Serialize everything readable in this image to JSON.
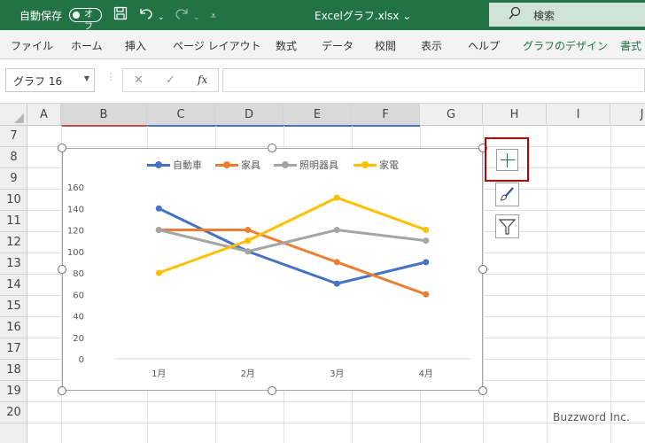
{
  "titlebar": {
    "autosave_label": "自動保存",
    "autosave_state": "オフ",
    "doc_title": "Excelグラフ.xlsx ⌄",
    "search_placeholder": "検索",
    "accent": "#217346"
  },
  "ribbon_tabs": [
    {
      "label": "ファイル",
      "active": false
    },
    {
      "label": "ホーム",
      "active": false
    },
    {
      "label": "挿入",
      "active": false
    },
    {
      "label": "ページ レイアウト",
      "active": false
    },
    {
      "label": "数式",
      "active": false
    },
    {
      "label": "データ",
      "active": false
    },
    {
      "label": "校閲",
      "active": false
    },
    {
      "label": "表示",
      "active": false
    },
    {
      "label": "ヘルプ",
      "active": false
    },
    {
      "label": "グラフのデザイン",
      "active": false
    },
    {
      "label": "書式",
      "active": false
    }
  ],
  "formula_bar": {
    "name_box": "グラフ 16",
    "formula": ""
  },
  "columns": [
    "A",
    "B",
    "C",
    "D",
    "E",
    "F",
    "G",
    "H",
    "I",
    "J"
  ],
  "rows": [
    "7",
    "8",
    "9",
    "10",
    "11",
    "12",
    "13",
    "14",
    "15",
    "16",
    "17",
    "18",
    "19",
    "20"
  ],
  "chart_data": {
    "type": "line",
    "categories": [
      "1月",
      "2月",
      "3月",
      "4月"
    ],
    "series": [
      {
        "name": "自動車",
        "color": "#4472c4",
        "values": [
          140,
          100,
          70,
          90
        ]
      },
      {
        "name": "家具",
        "color": "#ed7d31",
        "values": [
          120,
          120,
          90,
          60
        ]
      },
      {
        "name": "照明器具",
        "color": "#a5a5a5",
        "values": [
          120,
          100,
          120,
          110
        ]
      },
      {
        "name": "家電",
        "color": "#ffc000",
        "values": [
          80,
          110,
          150,
          120
        ]
      }
    ],
    "y_ticks": [
      "0",
      "20",
      "40",
      "60",
      "80",
      "100",
      "120",
      "140",
      "160"
    ],
    "ylim": [
      0,
      160
    ],
    "legend_position": "top",
    "grid": false
  },
  "chart_buttons": {
    "elements_icon": "plus-icon",
    "styles_icon": "brush-icon",
    "filter_icon": "filter-icon"
  },
  "watermark": "Buzzword Inc."
}
